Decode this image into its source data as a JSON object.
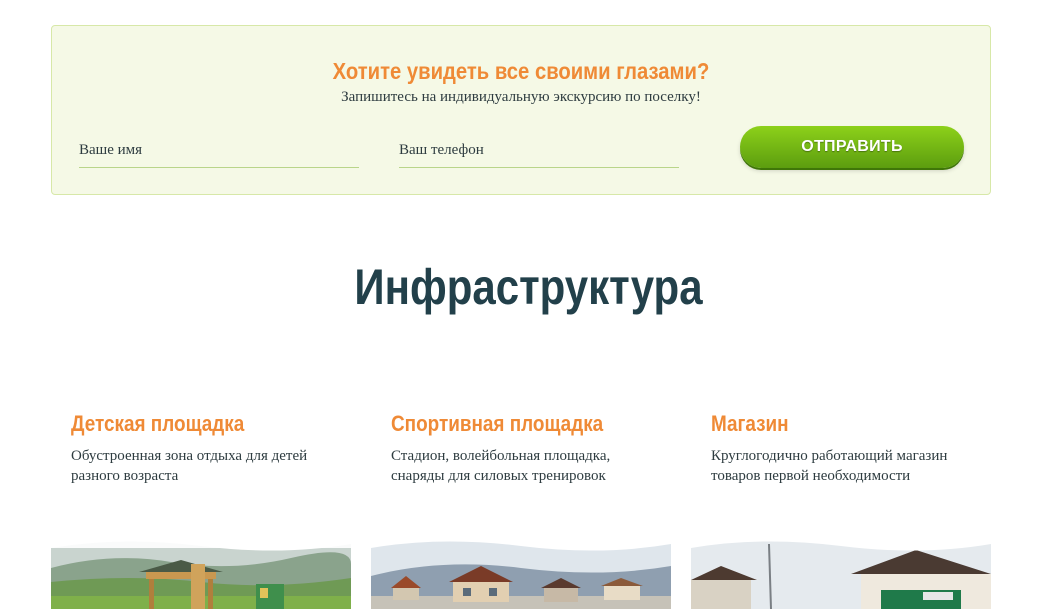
{
  "form": {
    "title": "Хотите увидеть все своими глазами?",
    "subtitle": "Запишитесь на индивидуальную экскурсию по поселку!",
    "name_placeholder": "Ваше имя",
    "phone_placeholder": "Ваш телефон",
    "submit_label": "ОТПРАВИТЬ"
  },
  "section": {
    "title": "Инфраструктура"
  },
  "cards": [
    {
      "title": "Детская площадка",
      "text": "Обустроенная зона отдыха для детей разного возраста"
    },
    {
      "title": "Спортивная площадка",
      "text": "Стадион, волейбольная площадка, снаряды для силовых тренировок"
    },
    {
      "title": "Магазин",
      "text": "Круглогодично работающий магазин товаров первой необходимости"
    }
  ],
  "colors": {
    "accent": "#ef8a36",
    "button": "#6fb514",
    "banner_bg": "#f5f9e6",
    "heading": "#22404a"
  }
}
